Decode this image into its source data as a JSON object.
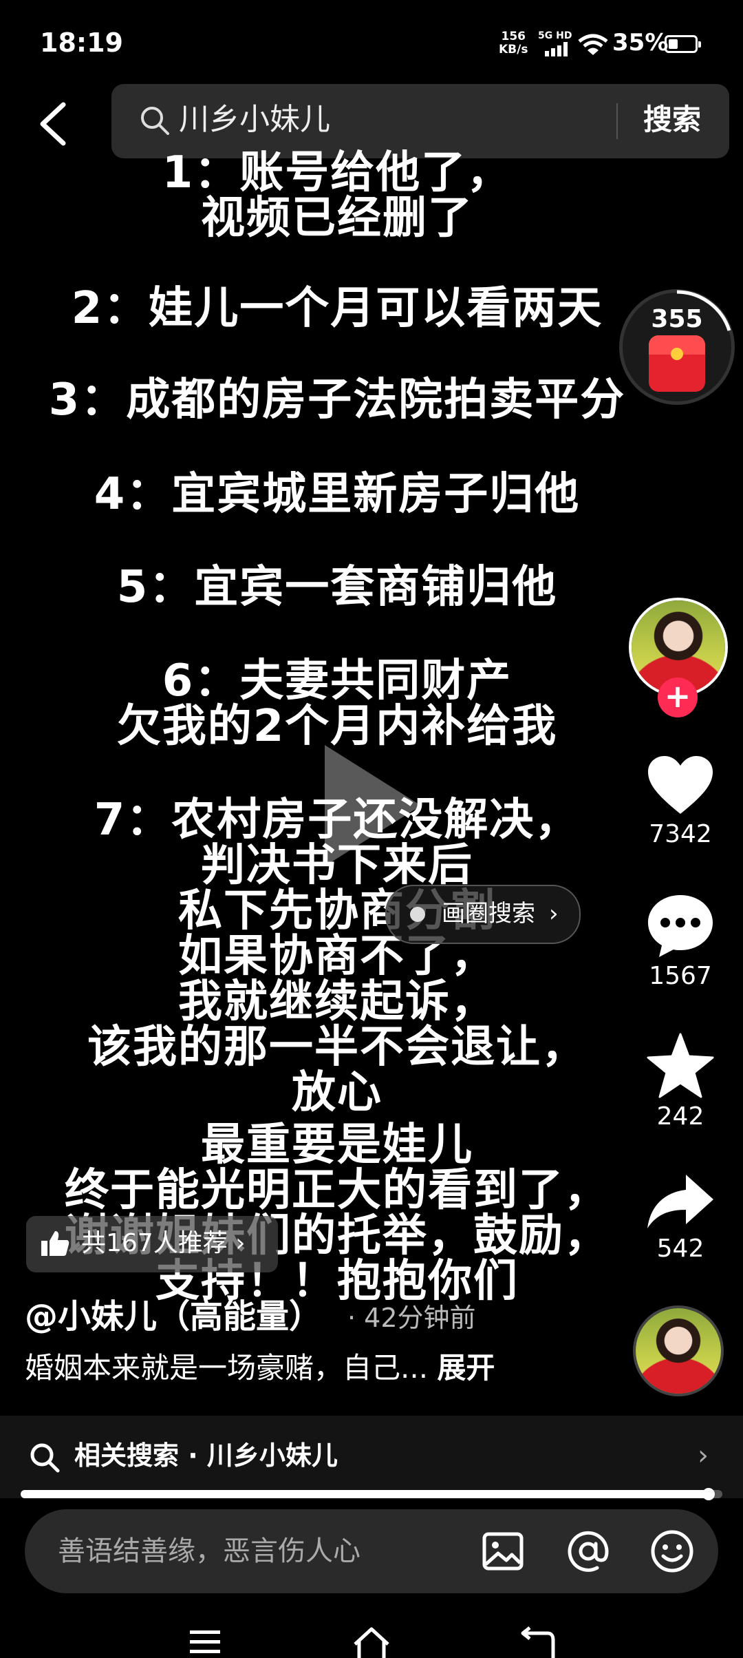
{
  "status_bar": {
    "time": "18:19",
    "net_speed_value": "156",
    "net_speed_unit": "KB/s",
    "network_label": "5G HD",
    "battery_percent": "35%",
    "battery_level": 0.35
  },
  "search": {
    "query": "川乡小妹儿",
    "button_label": "搜索"
  },
  "captions": [
    "1：账号给他了，",
    "视频已经删了",
    "2：娃儿一个月可以看两天",
    "3：成都的房子法院拍卖平分",
    "4：宜宾城里新房子归他",
    "5：宜宾一套商铺归他",
    "6：夫妻共同财产",
    "欠我的2个月内补给我",
    "7：农村房子还没解决，",
    "判决书下来后",
    "私下先协商分割",
    "如果协商不了，",
    "我就继续起诉，",
    "该我的那一半不会退让，",
    "放心",
    "最重要是娃儿",
    "终于能光明正大的看到了，",
    "谢谢姐妹们的托举，鼓励，",
    "支持！！抱抱你们"
  ],
  "image_search_chip": {
    "label": "画圈搜索",
    "chevron": "›"
  },
  "recommend_chip": {
    "label": "共167人推荐 ›"
  },
  "author": {
    "handle": "@小妹儿（高能量）",
    "post_time": "· 42分钟前",
    "description": "婚姻本来就是一场豪赌，自己...",
    "expand_label": "展开"
  },
  "rail": {
    "red_packet_count": "355",
    "likes": "7342",
    "comments": "1567",
    "favorites": "242",
    "shares": "542",
    "follow_symbol": "+"
  },
  "related_search": {
    "label": "相关搜索 · 川乡小妹儿",
    "chevron": "›"
  },
  "playback": {
    "progress": 0.98
  },
  "comment_bar": {
    "placeholder": "善语结善缘，恶言伤人心"
  },
  "colors": {
    "background": "#000000",
    "follow_accent": "#fe2c55",
    "red_packet": "#e4232e"
  },
  "icons": [
    "back-arrow-icon",
    "search-icon",
    "play-icon",
    "heart-icon",
    "comment-icon",
    "star-icon",
    "share-icon",
    "image-icon",
    "at-icon",
    "emoji-icon",
    "menu-icon",
    "home-icon",
    "back-nav-icon"
  ]
}
